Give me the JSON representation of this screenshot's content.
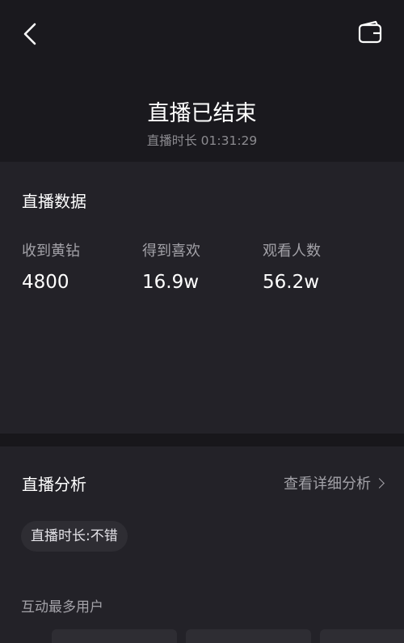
{
  "header": {
    "title": "直播已结束",
    "duration_label": "直播时长 01:31:29"
  },
  "live_data": {
    "title": "直播数据",
    "stats": [
      {
        "label": "收到黄钻",
        "value": "4800"
      },
      {
        "label": "得到喜欢",
        "value": "16.9w"
      },
      {
        "label": "观看人数",
        "value": "56.2w"
      }
    ]
  },
  "analysis": {
    "title": "直播分析",
    "detail_link": "查看详细分析",
    "tag": "直播时长:不错",
    "top_users_heading": "互动最多用户"
  }
}
